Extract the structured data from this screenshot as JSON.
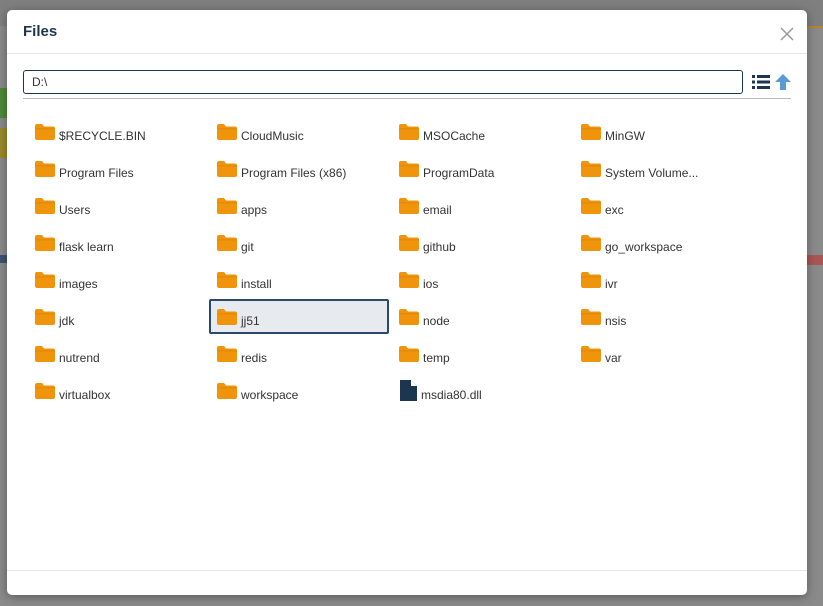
{
  "dialog": {
    "title": "Files",
    "path_value": "D:\\"
  },
  "items": [
    {
      "name": "$RECYCLE.BIN",
      "type": "folder"
    },
    {
      "name": "CloudMusic",
      "type": "folder"
    },
    {
      "name": "MSOCache",
      "type": "folder"
    },
    {
      "name": "MinGW",
      "type": "folder"
    },
    {
      "name": "Program Files",
      "type": "folder"
    },
    {
      "name": "Program Files (x86)",
      "type": "folder"
    },
    {
      "name": "ProgramData",
      "type": "folder"
    },
    {
      "name": "System Volume...",
      "type": "folder"
    },
    {
      "name": "Users",
      "type": "folder"
    },
    {
      "name": "apps",
      "type": "folder"
    },
    {
      "name": "email",
      "type": "folder"
    },
    {
      "name": "exc",
      "type": "folder"
    },
    {
      "name": "flask learn",
      "type": "folder"
    },
    {
      "name": "git",
      "type": "folder"
    },
    {
      "name": "github",
      "type": "folder"
    },
    {
      "name": "go_workspace",
      "type": "folder"
    },
    {
      "name": "images",
      "type": "folder"
    },
    {
      "name": "install",
      "type": "folder"
    },
    {
      "name": "ios",
      "type": "folder"
    },
    {
      "name": "ivr",
      "type": "folder"
    },
    {
      "name": "jdk",
      "type": "folder"
    },
    {
      "name": "jj51",
      "type": "folder"
    },
    {
      "name": "node",
      "type": "folder"
    },
    {
      "name": "nsis",
      "type": "folder"
    },
    {
      "name": "nutrend",
      "type": "folder"
    },
    {
      "name": "redis",
      "type": "folder"
    },
    {
      "name": "temp",
      "type": "folder"
    },
    {
      "name": "var",
      "type": "folder"
    },
    {
      "name": "virtualbox",
      "type": "folder"
    },
    {
      "name": "workspace",
      "type": "folder"
    },
    {
      "name": "msdia80.dll",
      "type": "file"
    }
  ],
  "selected_item": "jj51",
  "icons": {
    "close": "close-icon",
    "list_view": "list-view-icon",
    "up": "arrow-up-icon",
    "folder": "folder-icon",
    "file": "file-icon"
  },
  "colors": {
    "folder": "#f0950b",
    "file": "#1c3650",
    "title": "#1c3650",
    "up_arrow": "#5b9bd5",
    "selected_border": "#2a4a6a",
    "selected_bg": "#e7eaee"
  }
}
